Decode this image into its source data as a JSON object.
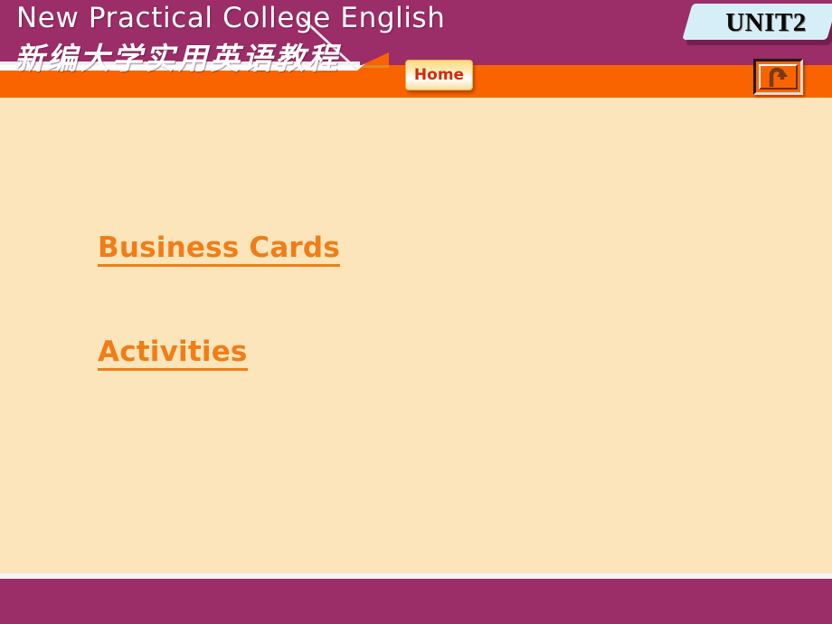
{
  "header": {
    "brand_en": "New Practical College English",
    "brand_cn": "新编大学实用英语教程",
    "unit_badge": "UNIT2",
    "home_label": "Home",
    "return_icon_name": "return-u-turn-arrow",
    "colors": {
      "purple": "#9b2d68",
      "orange": "#fa6400",
      "badge_blue": "#d6eef7",
      "home_text": "#d42a0a"
    }
  },
  "content": {
    "links": [
      {
        "label": "Business Cards"
      },
      {
        "label": "Activities"
      }
    ],
    "background": "#fce5ba",
    "link_color": "#f07d18"
  },
  "footer": {
    "color": "#9b2d68"
  }
}
